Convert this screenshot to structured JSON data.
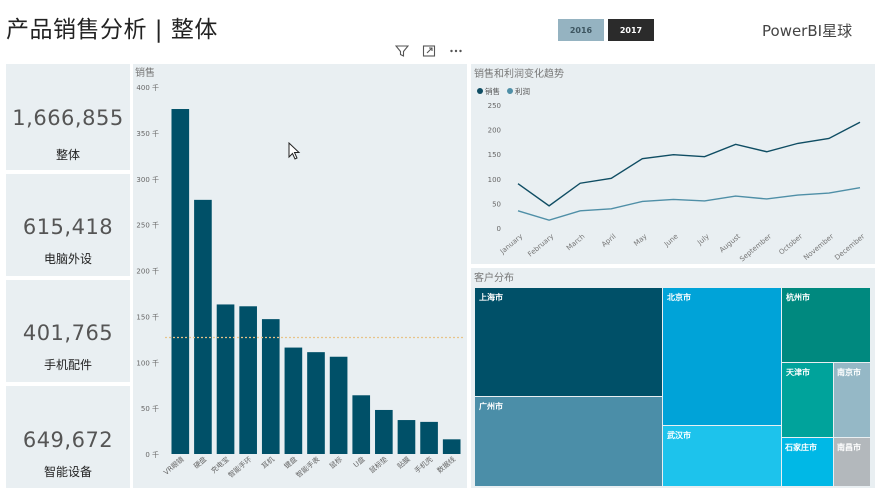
{
  "header": {
    "title": "产品销售分析 | 整体",
    "brand": "PowerBI星球",
    "years": [
      "2016",
      "2017"
    ],
    "selected_year": "2017"
  },
  "toolbar": {
    "icons": [
      "filter-icon",
      "focus-mode-icon",
      "more-options-icon"
    ]
  },
  "cards": [
    {
      "value": "1,666,855",
      "label": "整体"
    },
    {
      "value": "615,418",
      "label": "电脑外设"
    },
    {
      "value": "401,765",
      "label": "手机配件"
    },
    {
      "value": "649,672",
      "label": "智能设备"
    }
  ],
  "bar_panel": {
    "title": "销售"
  },
  "line_panel": {
    "title": "销售和利润变化趋势"
  },
  "treemap_panel": {
    "title": "客户分布",
    "cities": [
      "上海市",
      "广州市",
      "北京市",
      "武汉市",
      "杭州市",
      "天津市",
      "南京市",
      "石家庄市",
      "南昌市"
    ]
  },
  "colors": {
    "bar": "#005068",
    "sales_line": "#0f4d63",
    "profit_line": "#4f8fa7",
    "avg_line": "#e8c48a",
    "panel_bg": "#e9eff2"
  },
  "chart_data": [
    {
      "type": "bar",
      "title": "销售",
      "categories": [
        "VR眼镜",
        "硬盘",
        "充电宝",
        "智能手环",
        "耳机",
        "键盘",
        "智能手表",
        "鼠标",
        "U盘",
        "鼠标垫",
        "贴膜",
        "手机壳",
        "数据线"
      ],
      "values": [
        376,
        277,
        163,
        161,
        147,
        116,
        111,
        106,
        64,
        48,
        37,
        35,
        16
      ],
      "unit_suffix": " 千",
      "yticks": [
        0,
        50,
        100,
        150,
        200,
        250,
        300,
        350,
        400
      ],
      "ylim": [
        0,
        400
      ],
      "average_line": 127,
      "grid": false
    },
    {
      "type": "line",
      "title": "销售和利润变化趋势",
      "categories": [
        "January",
        "February",
        "March",
        "April",
        "May",
        "June",
        "July",
        "August",
        "September",
        "October",
        "November",
        "December"
      ],
      "series": [
        {
          "name": "销售",
          "values": [
            90,
            45,
            91,
            101,
            141,
            149,
            145,
            170,
            155,
            172,
            182,
            215
          ]
        },
        {
          "name": "利润",
          "values": [
            35,
            16,
            35,
            39,
            54,
            58,
            55,
            65,
            59,
            67,
            71,
            82
          ]
        }
      ],
      "yticks": [
        0,
        50,
        100,
        150,
        200,
        250
      ],
      "ylim": [
        0,
        250
      ],
      "legend": "top-left",
      "grid": false
    }
  ]
}
